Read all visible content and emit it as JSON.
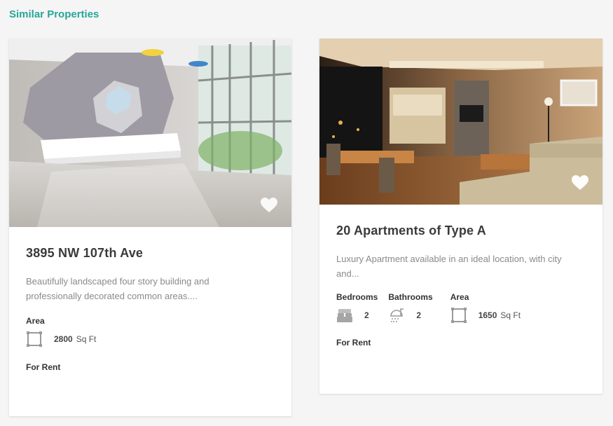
{
  "section": {
    "title": "Similar Properties"
  },
  "colors": {
    "accent": "#26a69a"
  },
  "properties": [
    {
      "title": "3895 NW 107th Ave",
      "description": "Beautifully landscaped four story building and professionally decorated common areas....",
      "features": [
        {
          "label": "Area",
          "icon": "area-icon",
          "value": "2800",
          "unit": "Sq Ft"
        }
      ],
      "status": "For Rent",
      "favorite_icon": "heart-icon"
    },
    {
      "title": "20 Apartments of Type A",
      "description": "Luxury Apartment available in an ideal location, with city and...",
      "features": [
        {
          "label": "Bedrooms",
          "icon": "bed-icon",
          "value": "2"
        },
        {
          "label": "Bathrooms",
          "icon": "shower-icon",
          "value": "2"
        },
        {
          "label": "Area",
          "icon": "area-icon",
          "value": "1650",
          "unit": "Sq Ft"
        }
      ],
      "status": "For Rent",
      "favorite_icon": "heart-icon"
    }
  ]
}
